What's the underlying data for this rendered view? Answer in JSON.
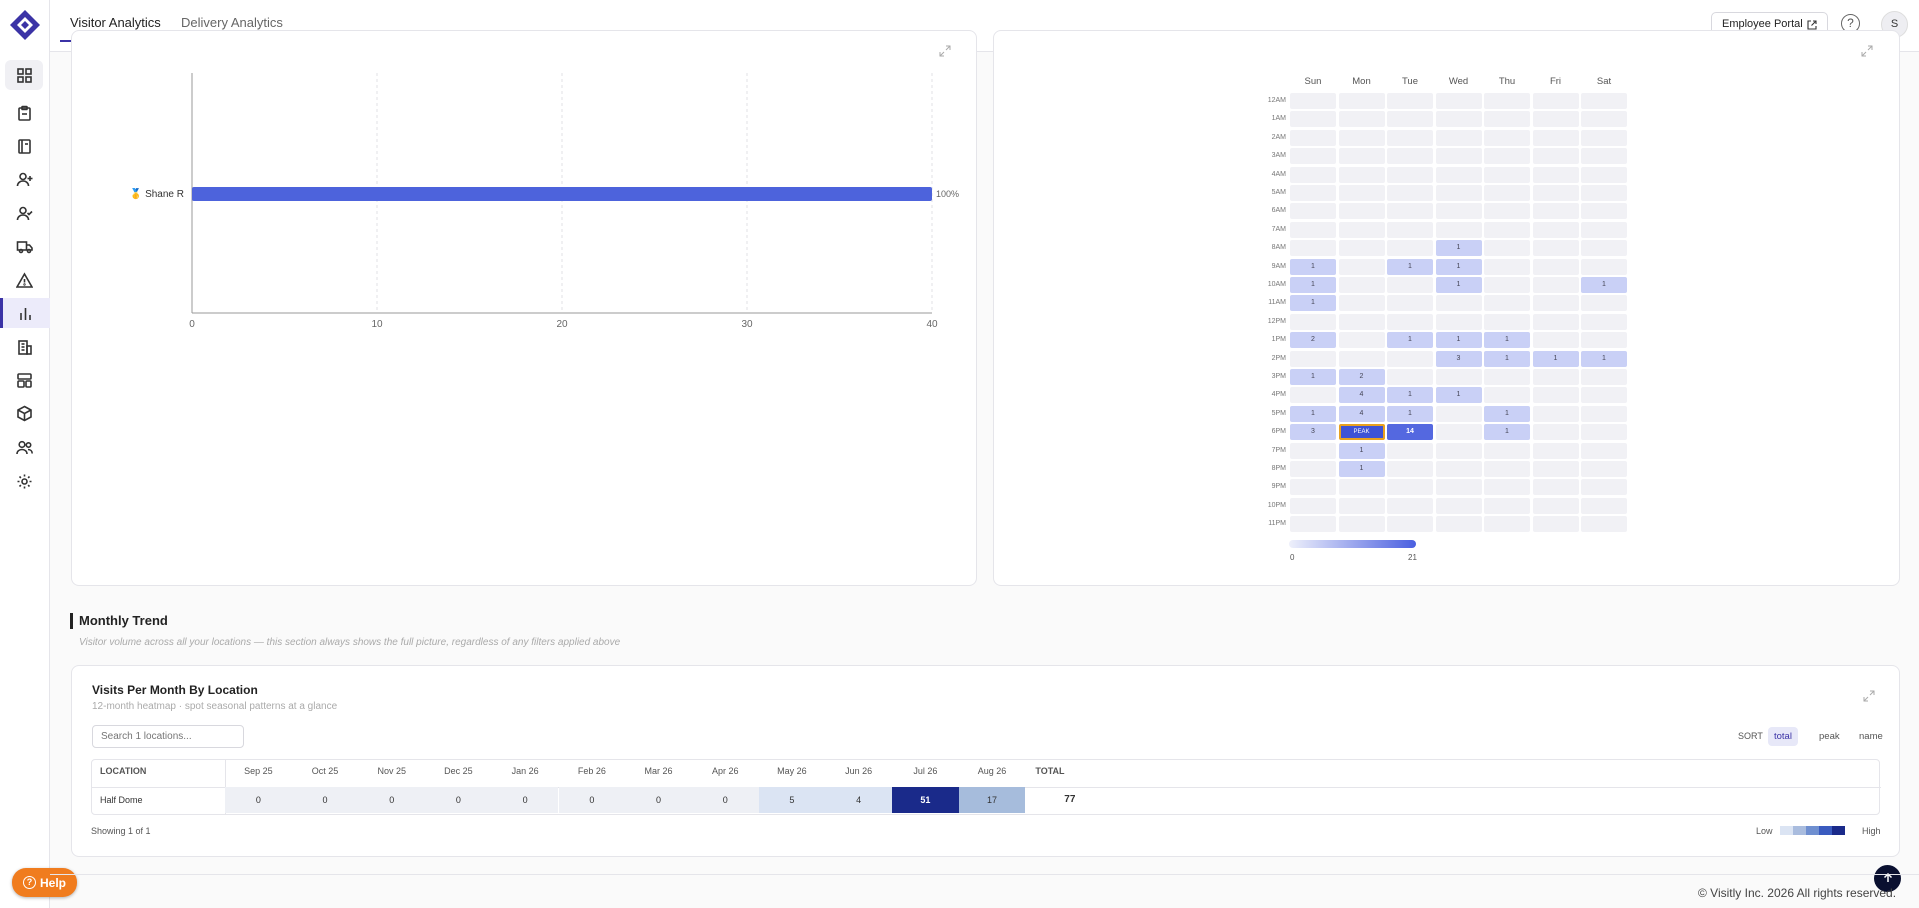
{
  "header": {
    "tabs": [
      "Visitor Analytics",
      "Delivery Analytics"
    ],
    "employee_portal": "Employee Portal",
    "help_symbol": "?",
    "avatar_initial": "S"
  },
  "sidebar": {
    "icons": [
      "dashboard-icon",
      "clipboard-icon",
      "notebook-icon",
      "user-add-icon",
      "user-check-icon",
      "truck-icon",
      "warning-icon",
      "bar-chart-icon",
      "building-icon",
      "layout-icon",
      "box-icon",
      "users-icon",
      "gear-icon"
    ],
    "active_index": 7
  },
  "bar_chart": {
    "category": "🥇 Shane R",
    "value_label": "100%",
    "ticks": [
      "0",
      "10",
      "20",
      "30",
      "40"
    ],
    "chart_data": {
      "type": "bar",
      "categories": [
        "Shane R"
      ],
      "values": [
        40
      ],
      "xlim": [
        0,
        40
      ]
    }
  },
  "heatmap": {
    "days": [
      "Sun",
      "Mon",
      "Tue",
      "Wed",
      "Thu",
      "Fri",
      "Sat"
    ],
    "hours": [
      "12AM",
      "1AM",
      "2AM",
      "3AM",
      "4AM",
      "5AM",
      "6AM",
      "7AM",
      "8AM",
      "9AM",
      "10AM",
      "11AM",
      "12PM",
      "1PM",
      "2PM",
      "3PM",
      "4PM",
      "5PM",
      "6PM",
      "7PM",
      "8PM",
      "9PM",
      "10PM",
      "11PM"
    ],
    "peak_label": "PEAK",
    "legend_min": "0",
    "legend_max": "21",
    "chart_data": {
      "type": "heatmap",
      "x": [
        "Sun",
        "Mon",
        "Tue",
        "Wed",
        "Thu",
        "Fri",
        "Sat"
      ],
      "y": [
        "12AM",
        "1AM",
        "2AM",
        "3AM",
        "4AM",
        "5AM",
        "6AM",
        "7AM",
        "8AM",
        "9AM",
        "10AM",
        "11AM",
        "12PM",
        "1PM",
        "2PM",
        "3PM",
        "4PM",
        "5PM",
        "6PM",
        "7PM",
        "8PM",
        "9PM",
        "10PM",
        "11PM"
      ],
      "values": [
        [
          0,
          0,
          0,
          0,
          0,
          0,
          0
        ],
        [
          0,
          0,
          0,
          0,
          0,
          0,
          0
        ],
        [
          0,
          0,
          0,
          0,
          0,
          0,
          0
        ],
        [
          0,
          0,
          0,
          0,
          0,
          0,
          0
        ],
        [
          0,
          0,
          0,
          0,
          0,
          0,
          0
        ],
        [
          0,
          0,
          0,
          0,
          0,
          0,
          0
        ],
        [
          0,
          0,
          0,
          0,
          0,
          0,
          0
        ],
        [
          0,
          0,
          0,
          0,
          0,
          0,
          0
        ],
        [
          0,
          0,
          0,
          1,
          0,
          0,
          0
        ],
        [
          1,
          0,
          1,
          1,
          0,
          0,
          0
        ],
        [
          1,
          0,
          0,
          1,
          0,
          0,
          1
        ],
        [
          1,
          0,
          0,
          0,
          0,
          0,
          0
        ],
        [
          0,
          0,
          0,
          0,
          0,
          0,
          0
        ],
        [
          2,
          0,
          1,
          1,
          1,
          0,
          0
        ],
        [
          0,
          0,
          0,
          3,
          1,
          1,
          1
        ],
        [
          1,
          2,
          0,
          0,
          0,
          0,
          0
        ],
        [
          0,
          4,
          1,
          1,
          0,
          0,
          0
        ],
        [
          1,
          4,
          1,
          0,
          1,
          0,
          0
        ],
        [
          3,
          21,
          14,
          0,
          1,
          0,
          0
        ],
        [
          0,
          1,
          0,
          0,
          0,
          0,
          0
        ],
        [
          0,
          1,
          0,
          0,
          0,
          0,
          0
        ],
        [
          0,
          0,
          0,
          0,
          0,
          0,
          0
        ],
        [
          0,
          0,
          0,
          0,
          0,
          0,
          0
        ],
        [
          0,
          0,
          0,
          0,
          0,
          0,
          0
        ]
      ],
      "range": [
        0,
        21
      ]
    }
  },
  "monthly": {
    "section_title": "Monthly Trend",
    "section_subtitle": "Visitor volume across all your locations — this section always shows the full picture, regardless of any filters applied above",
    "card_title": "Visits Per Month By Location",
    "card_subtitle": "12-month heatmap · spot seasonal patterns at a glance",
    "search_placeholder": "Search 1 locations...",
    "sort_label": "SORT",
    "sort_options": [
      "total",
      "peak",
      "name"
    ],
    "location_header": "LOCATION",
    "total_header": "TOTAL",
    "months": [
      "Sep 25",
      "Oct 25",
      "Nov 25",
      "Dec 25",
      "Jan 26",
      "Feb 26",
      "Mar 26",
      "Apr 26",
      "May 26",
      "Jun 26",
      "Jul 26",
      "Aug 26"
    ],
    "rows": [
      {
        "location": "Half Dome",
        "values": [
          "0",
          "0",
          "0",
          "0",
          "0",
          "0",
          "0",
          "0",
          "5",
          "4",
          "51",
          "17"
        ],
        "total": "77"
      }
    ],
    "showing": "Showing 1 of 1",
    "legend_low": "Low",
    "legend_high": "High"
  },
  "help_label": "Help",
  "footer": "© Visitly Inc. 2026 All rights reserved."
}
